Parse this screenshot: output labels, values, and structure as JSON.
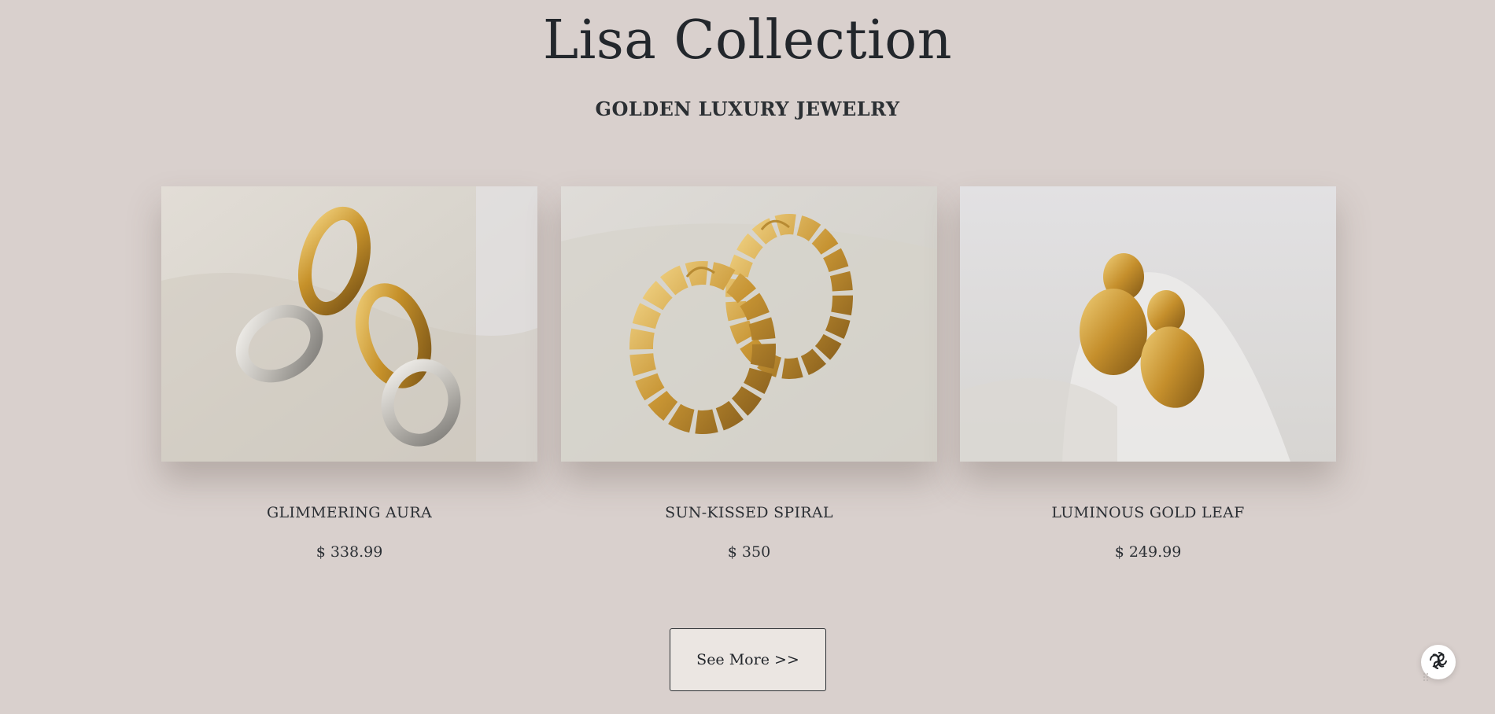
{
  "header": {
    "title": "Lisa Collection",
    "subtitle": "GOLDEN LUXURY JEWELRY"
  },
  "products": [
    {
      "name": "GLIMMERING AURA",
      "price": "$ 338.99",
      "image": "gold-and-silver-link-earrings"
    },
    {
      "name": "SUN-KISSED SPIRAL",
      "price": "$ 350",
      "image": "twisted-gold-hoop-earrings"
    },
    {
      "name": "LUMINOUS GOLD LEAF",
      "price": "$ 249.99",
      "image": "gold-leaf-drop-earrings"
    }
  ],
  "actions": {
    "see_more_label": "See More >>"
  },
  "widgets": {
    "chat_icon": "chat-assistant-icon"
  },
  "colors": {
    "background": "#d9d0cd",
    "text": "#23272c",
    "gold": "#c9952d",
    "silver": "#c8c6c2",
    "button_bg": "#ebe6e2"
  }
}
